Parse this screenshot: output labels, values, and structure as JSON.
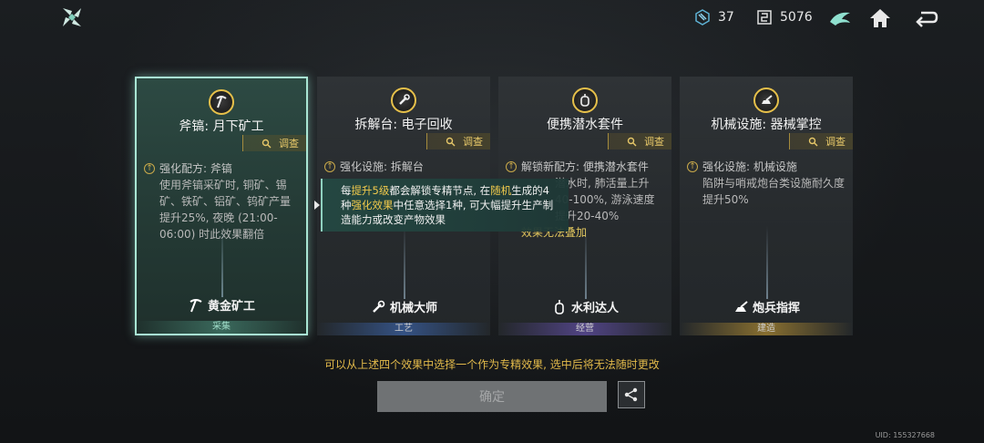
{
  "header": {
    "resources": [
      {
        "icon": "cube-icon",
        "value": "37"
      },
      {
        "icon": "coin-icon",
        "value": "5076"
      }
    ]
  },
  "cards": [
    {
      "icon": "pickaxe-icon",
      "title": "斧镐: 月下矿工",
      "inspect_label": "调查",
      "effect_head": "强化配方: 斧镐",
      "effect_desc": "使用斧镐采矿时, 铜矿、锡矿、铁矿、铝矿、钨矿产量提升25%, 夜晚 (21:00-06:00) 时此效果翻倍",
      "effect_note": "",
      "role": "黄金矿工",
      "role_icon": "pickaxe-icon",
      "category": "采集",
      "selected": true
    },
    {
      "icon": "wrench-icon",
      "title": "拆解台: 电子回收",
      "inspect_label": "调查",
      "effect_head": "强化设施: 拆解台",
      "effect_desc": "",
      "effect_note": "",
      "role": "机械大师",
      "role_icon": "wrench-icon",
      "category": "工艺",
      "selected": false
    },
    {
      "icon": "diving-tank-icon",
      "title": "便携潜水套件",
      "inspect_label": "调查",
      "effect_head": "解锁新配方: 便携潜水套件",
      "effect_desc": "潜水时, 肺活量上升40-100%, 游泳速度提升20-40%",
      "effect_note": "效果无法叠加",
      "role": "水利达人",
      "role_icon": "diving-tank-icon",
      "category": "经营",
      "selected": false
    },
    {
      "icon": "turret-icon",
      "title": "机械设施: 器械掌控",
      "inspect_label": "调查",
      "effect_head": "强化设施: 机械设施",
      "effect_desc": "陷阱与哨戒炮台类设施耐久度提升50%",
      "effect_note": "",
      "role": "炮兵指挥",
      "role_icon": "turret-icon",
      "category": "建造",
      "selected": false
    }
  ],
  "tooltip": {
    "t1": "每",
    "t2": "提升5级",
    "t3": "都会解锁专精节点, 在",
    "t4": "随机",
    "t5": "生成的4种",
    "t6": "强化效果",
    "t7": "中任意选择1种, 可大幅提升生产制造能力或改变产物效果"
  },
  "footer": {
    "hint": "可以从上述四个效果中选择一个作为专精效果, 选中后将无法随时更改",
    "confirm_label": "确定",
    "uid": "UID: 155327668"
  },
  "colors": {
    "accent_teal": "#a9e6d4",
    "gold": "#e1b94a",
    "tooltip_highlight": "#f0c94c"
  }
}
